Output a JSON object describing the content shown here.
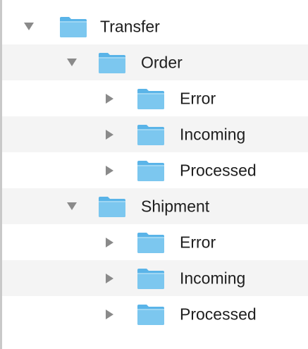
{
  "colors": {
    "folder_blue": "#7cc7ef",
    "folder_tab": "#5ab4e8",
    "disclosure_gray": "#8a8a8a",
    "stripe": "#f4f4f4",
    "text": "#1e1e1e"
  },
  "tree": {
    "root": {
      "label": "Transfer",
      "expanded": true,
      "icon": "folder-icon",
      "children": [
        {
          "label": "Order",
          "expanded": true,
          "icon": "folder-icon",
          "children": [
            {
              "label": "Error",
              "expanded": false,
              "icon": "folder-icon"
            },
            {
              "label": "Incoming",
              "expanded": false,
              "icon": "folder-icon"
            },
            {
              "label": "Processed",
              "expanded": false,
              "icon": "folder-icon"
            }
          ]
        },
        {
          "label": "Shipment",
          "expanded": true,
          "icon": "folder-icon",
          "children": [
            {
              "label": "Error",
              "expanded": false,
              "icon": "folder-icon"
            },
            {
              "label": "Incoming",
              "expanded": false,
              "icon": "folder-icon"
            },
            {
              "label": "Processed",
              "expanded": false,
              "icon": "folder-icon"
            }
          ]
        }
      ]
    }
  }
}
